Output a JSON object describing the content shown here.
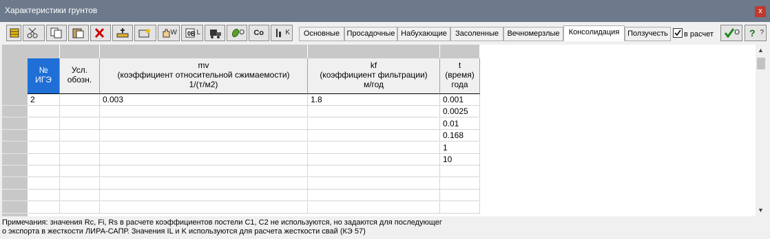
{
  "window": {
    "title": "Характеристики грунтов",
    "close_label": "x"
  },
  "toolbar": {
    "buttons": [
      {
        "name": "table-icon-button",
        "label": ""
      },
      {
        "name": "cut-button",
        "label": ""
      },
      {
        "name": "copy-button",
        "label": ""
      },
      {
        "name": "paste-button",
        "label": ""
      },
      {
        "name": "delete-button",
        "label": ""
      },
      {
        "name": "insert-row-button",
        "label": ""
      },
      {
        "name": "fill-button",
        "label": ""
      },
      {
        "name": "hand-button",
        "label": "W"
      },
      {
        "name": "sort-button",
        "label": "L"
      },
      {
        "name": "calc-button",
        "label": ""
      },
      {
        "name": "leaf-button",
        "label": "O"
      },
      {
        "name": "co-button",
        "label": "Cо"
      },
      {
        "name": "k-button",
        "label": "K"
      }
    ],
    "ok_label": "O",
    "help_label": "?"
  },
  "tabs": [
    {
      "label": "Основные",
      "active": false
    },
    {
      "label": "Просадочные",
      "active": false
    },
    {
      "label": "Набухающие",
      "active": false
    },
    {
      "label": "Засоленные",
      "active": false
    },
    {
      "label": "Вечномерзлые",
      "active": false
    },
    {
      "label": "Консолидация",
      "active": true
    },
    {
      "label": "Ползучесть",
      "active": false
    }
  ],
  "in_calc_checkbox": {
    "label": "в расчет",
    "checked": true
  },
  "grid": {
    "headers": {
      "ige": [
        "№",
        "ИГЭ"
      ],
      "usl": [
        "Усл.",
        "обозн."
      ],
      "mv": [
        "mv",
        "(коэффициент относительной сжимаемости)",
        "1/(т/м2)"
      ],
      "kf": [
        "kf",
        "(коэффициент фильтрации)",
        "м/год"
      ],
      "t": [
        "t",
        "(время)",
        "года"
      ]
    },
    "rows": [
      {
        "ige": "2",
        "usl": "",
        "mv": "0.003",
        "kf": "1.8",
        "t": "0.001"
      },
      {
        "ige": "",
        "usl": "",
        "mv": "",
        "kf": "",
        "t": "0.0025"
      },
      {
        "ige": "",
        "usl": "",
        "mv": "",
        "kf": "",
        "t": "0.01"
      },
      {
        "ige": "",
        "usl": "",
        "mv": "",
        "kf": "",
        "t": "0.168"
      },
      {
        "ige": "",
        "usl": "",
        "mv": "",
        "kf": "",
        "t": "1"
      },
      {
        "ige": "",
        "usl": "",
        "mv": "",
        "kf": "",
        "t": "10"
      },
      {
        "ige": "",
        "usl": "",
        "mv": "",
        "kf": "",
        "t": ""
      },
      {
        "ige": "",
        "usl": "",
        "mv": "",
        "kf": "",
        "t": ""
      },
      {
        "ige": "",
        "usl": "",
        "mv": "",
        "kf": "",
        "t": ""
      },
      {
        "ige": "",
        "usl": "",
        "mv": "",
        "kf": "",
        "t": ""
      }
    ]
  },
  "footer": {
    "line1": "Примечания: значения Rc, Fi, Rs в расчете коэффициентов постели С1, С2 не используются, но задаются для последующег",
    "line2": "о экспорта в жесткости ЛИРА-САПР. Значения IL и K используются для расчета жесткости свай (КЭ 57)"
  },
  "colors": {
    "titlebar": "#6d7a8c",
    "selected_header": "#1f6fd6",
    "close": "#c0392b"
  }
}
